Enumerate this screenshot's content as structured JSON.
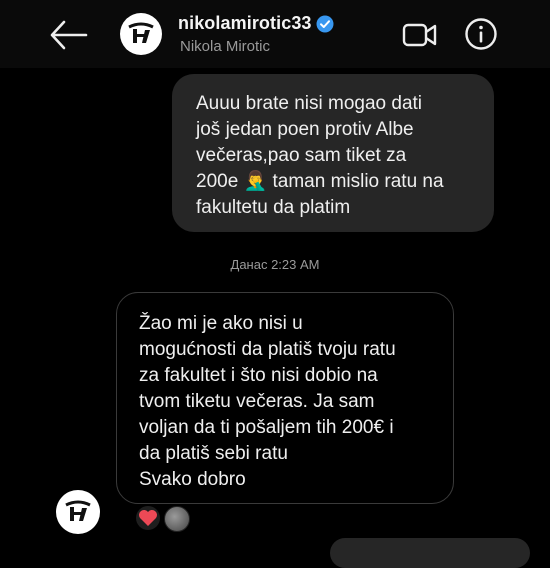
{
  "header": {
    "username": "nikolamirotic33",
    "full_name": "Nikola Mirotic",
    "icons": [
      "back-arrow-icon",
      "verified-badge-icon",
      "video-call-icon",
      "info-icon"
    ]
  },
  "messages": {
    "sent": {
      "text": "Auuu brate nisi mogao dati\njoš jedan poen protiv Albe\nvečeras,pao sam tiket za\n200e 🤦‍♂️ taman mislio ratu na\nfakultetu da platim"
    },
    "timestamp": "Данас 2:23 AM",
    "received": {
      "text": "Žao mi je ako nisi u\nmogućnosti da platiš tvoju ratu\nza fakultet i što nisi dobio na\ntvom tiketu večeras.  Ja sam\nvoljan da ti pošaljem tih 200€ i\nda platiš sebi ratu\nSvako dobro"
    },
    "reactions": [
      "heart-reaction-icon",
      "reactor-avatar"
    ]
  },
  "colors": {
    "background": "#000000",
    "sent_bubble": "#262626",
    "received_border": "#3a3a3a",
    "verified": "#3897f0",
    "heart": "#ed4956"
  }
}
